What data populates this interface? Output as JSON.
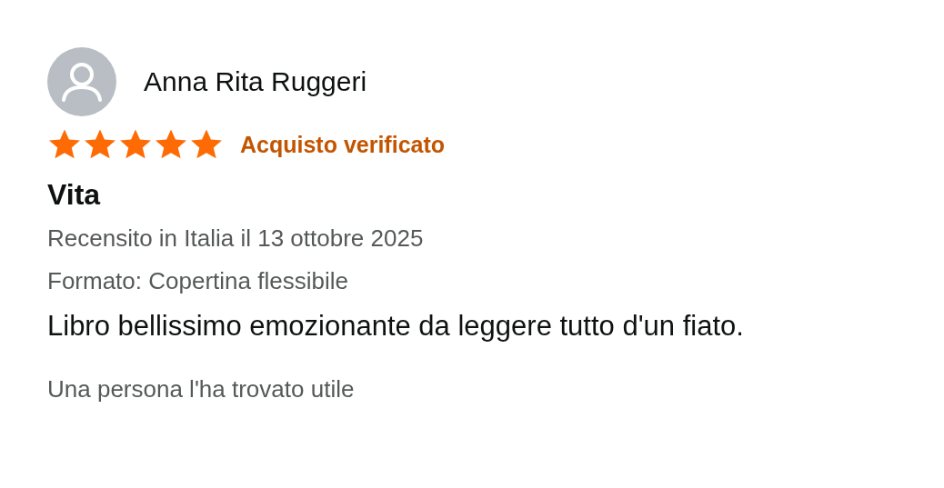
{
  "review": {
    "author": "Anna Rita Ruggeri",
    "stars": 5,
    "badge": "Acquisto verificato",
    "title": "Vita",
    "meta": [
      "Recensito in Italia il 13 ottobre 2025",
      "Formato: Copertina flessibile"
    ],
    "body": "Libro bellissimo emozionante da leggere tutto d'un fiato.",
    "helpful": "Una persona l'ha trovato utile"
  }
}
